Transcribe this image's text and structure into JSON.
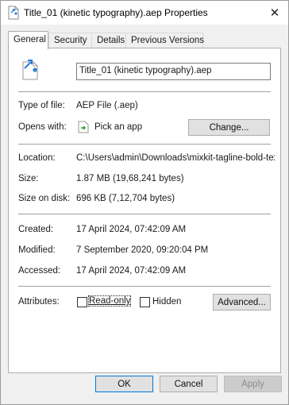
{
  "window": {
    "title": "Title_01 (kinetic typography).aep Properties",
    "close_glyph": "✕"
  },
  "tabs": [
    {
      "label": "General",
      "active": true
    },
    {
      "label": "Security",
      "active": false
    },
    {
      "label": "Details",
      "active": false
    },
    {
      "label": "Previous Versions",
      "active": false
    }
  ],
  "general": {
    "file_name": "Title_01 (kinetic typography).aep",
    "type_of_file_label": "Type of file:",
    "type_of_file_value": "AEP File (.aep)",
    "opens_with_label": "Opens with:",
    "opens_with_value": "Pick an app",
    "change_button": "Change...",
    "location_label": "Location:",
    "location_value": "C:\\Users\\admin\\Downloads\\mixkit-tagline-bold-text-",
    "size_label": "Size:",
    "size_value": "1.87 MB (19,68,241 bytes)",
    "size_on_disk_label": "Size on disk:",
    "size_on_disk_value": "696 KB (7,12,704 bytes)",
    "created_label": "Created:",
    "created_value": "17 April 2024, 07:42:09 AM",
    "modified_label": "Modified:",
    "modified_value": "7 September 2020, 09:20:04 PM",
    "accessed_label": "Accessed:",
    "accessed_value": "17 April 2024, 07:42:09 AM",
    "attributes_label": "Attributes:",
    "readonly_label": "Read-only",
    "hidden_label": "Hidden",
    "advanced_button": "Advanced..."
  },
  "footer": {
    "ok": "OK",
    "cancel": "Cancel",
    "apply": "Apply"
  }
}
